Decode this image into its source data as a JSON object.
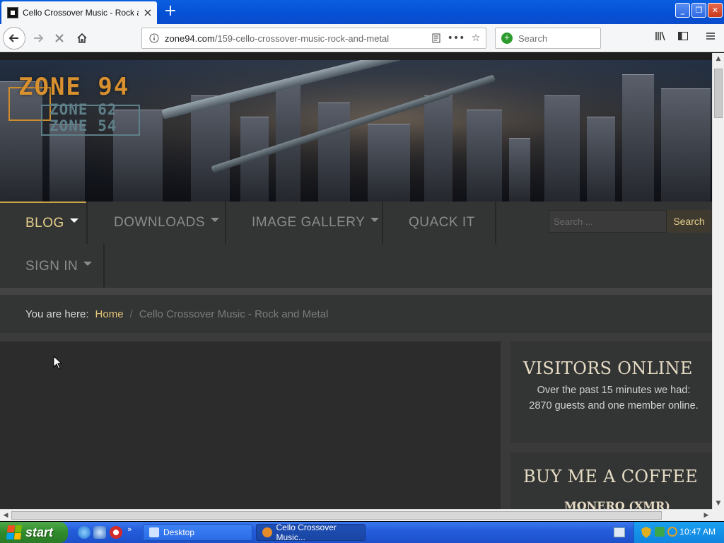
{
  "browser": {
    "tab_title": "Cello Crossover Music - Rock and Metal",
    "tab_close": "×",
    "new_tab": "+",
    "url_host": "zone94.com",
    "url_path": "/159-cello-crossover-music-rock-and-metal",
    "search_placeholder": "Search",
    "window_buttons": [
      "_",
      "❐",
      "✕"
    ]
  },
  "site": {
    "logo": {
      "line1": "ZONE 94",
      "line2": "ZONE 62",
      "line3": "ZONE 54"
    },
    "menu": [
      {
        "label": "BLOG",
        "dropdown": true,
        "active": true
      },
      {
        "label": "DOWNLOADS",
        "dropdown": true,
        "active": false
      },
      {
        "label": "IMAGE GALLERY",
        "dropdown": true,
        "active": false
      },
      {
        "label": "QUACK IT",
        "dropdown": false,
        "active": false
      },
      {
        "label": "SIGN IN",
        "dropdown": true,
        "active": false
      }
    ],
    "search": {
      "placeholder": "Search ...",
      "button": "Search"
    },
    "breadcrumb": {
      "label": "You are here:",
      "home": "Home",
      "separator": "/",
      "current": "Cello Crossover Music - Rock and Metal"
    },
    "sidebar": {
      "visitors": {
        "title": "VISITORS ONLINE",
        "text": "Over the past 15 minutes we had: 2870 guests and one member online."
      },
      "coffee": {
        "title": "BUY ME A COFFEE",
        "subtitle": "MONERO (XMR)"
      }
    }
  },
  "taskbar": {
    "start_label": "start",
    "tasks": [
      {
        "label": "Desktop"
      },
      {
        "label": "Cello Crossover Music..."
      }
    ],
    "clock": "10:47 AM"
  },
  "colors": {
    "accent_gold": "#e3c478",
    "menu_text": "#8b8b8b",
    "panel_bg": "#333434",
    "xp_blue": "#245ddb"
  }
}
